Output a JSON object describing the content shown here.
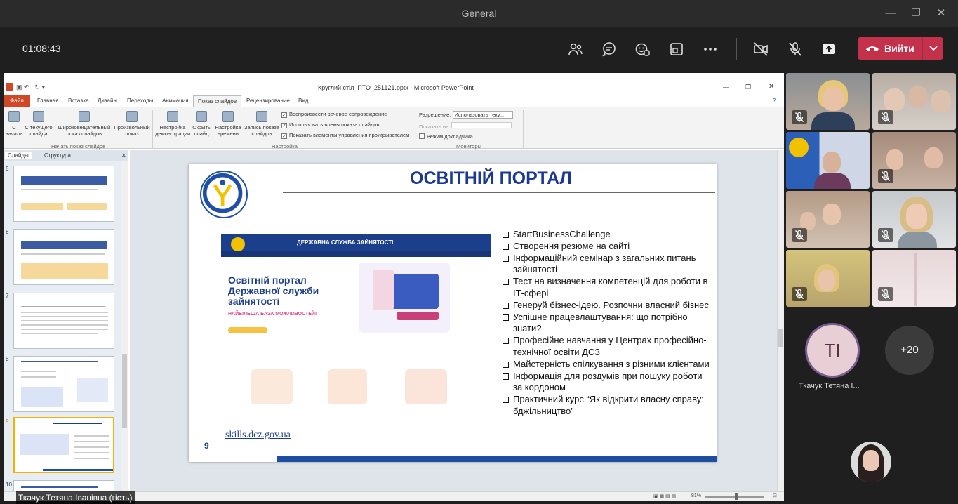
{
  "window": {
    "title": "General"
  },
  "meeting": {
    "timer": "01:08:43",
    "leave_label": "Вийти"
  },
  "icons": [
    "people-icon",
    "chat-icon",
    "reactions-icon",
    "rooms-icon",
    "more-icon",
    "camera-off-icon",
    "mic-off-icon",
    "share-icon",
    "hangup-icon",
    "chevron-down-icon"
  ],
  "ppt": {
    "title": "Круглий стіл_ПТО_251121.pptx - Microsoft PowerPoint",
    "tabs": [
      "Файл",
      "Главная",
      "Вставка",
      "Дизайн",
      "Переходы",
      "Анимация",
      "Показ слайдов",
      "Рецензирование",
      "Вид"
    ],
    "ribbon": {
      "from_start": "С начала",
      "from_current": "С текущего слайда",
      "broadcast": "Широковещательный показ слайдов",
      "custom": "Произвольный показ",
      "group1": "Начать показ слайдов",
      "setup": "Настройка демонстрации",
      "hide": "Скрыть слайд",
      "rehearse": "Настройка времени",
      "record": "Запись показа слайдов",
      "chk_narration": "Воспроизвести речевое сопровождение",
      "chk_timing": "Использовать время показа слайдов",
      "chk_controls": "Показать элементы управления проигрывателем",
      "group2": "Настройка",
      "resolution_label": "Разрешение:",
      "resolution_value": "Использовать теку...",
      "show_on": "Показать на:",
      "presenter": "Режим докладчика",
      "group3": "Мониторы"
    },
    "sidepanel": {
      "tab_slides": "Слайды",
      "tab_outline": "Структура",
      "numbers": [
        "5",
        "6",
        "7",
        "8",
        "9",
        "10"
      ]
    },
    "slide": {
      "title": "ОСВІТНІЙ ПОРТАЛ",
      "page_number": "9",
      "url": "skills.dcz.gov.ua",
      "portal_header": "ДЕРЖАВНА СЛУЖБА ЗАЙНЯТОСТІ",
      "portal_heading": "Освітній портал Державної служби зайнятості",
      "portal_sub": "НАЙБІЛЬША БАЗА МОЖЛИВОСТЕЙ!",
      "items": [
        "StartBusinessChallenge",
        "Створення резюме на сайті",
        "Інформаційний семінар з загальних питань зайнятості",
        "Тест на визначення компетенцій для роботи в ІТ-сфері",
        "Генеруй бізнес-ідею. Розпочни власний бізнес",
        "Успішне працевлаштування: що потрібно знати?",
        "Професійне навчання у Центрах професійно-технічної освіти ДСЗ",
        "Майстерність спілкування з різними клієнтами",
        "Інформація для роздумів при пошуку роботи за кордоном",
        "Практичний курс “Як відкрити власну справу: бджільництво”"
      ]
    },
    "zoom": "81%"
  },
  "presenter_caption": "Ткачук Тетяна Іванівна (гість)",
  "participants": {
    "avatar_initials": "TI",
    "avatar_name": "Ткачук Тетяна І...",
    "more_count": "+20"
  },
  "colors": {
    "leave": "#c4314b",
    "slide_blue": "#1b3a8f"
  }
}
